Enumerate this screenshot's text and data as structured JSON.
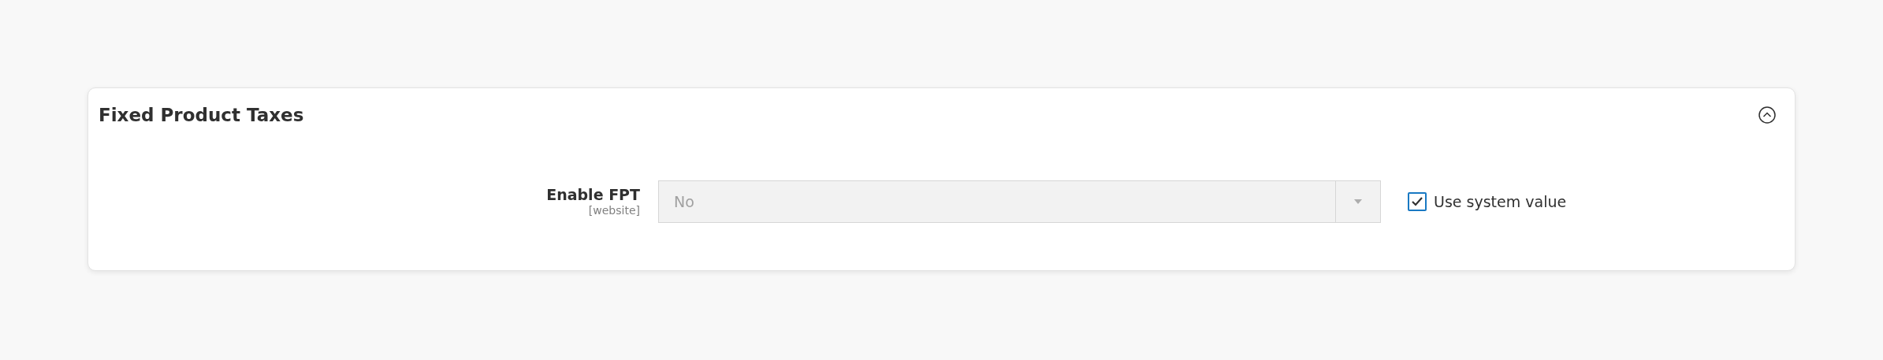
{
  "section": {
    "title": "Fixed Product Taxes",
    "expanded": true
  },
  "field": {
    "label": "Enable FPT",
    "scope": "[website]",
    "value": "No",
    "disabled": true
  },
  "use_system_value": {
    "label": "Use system value",
    "checked": true
  }
}
